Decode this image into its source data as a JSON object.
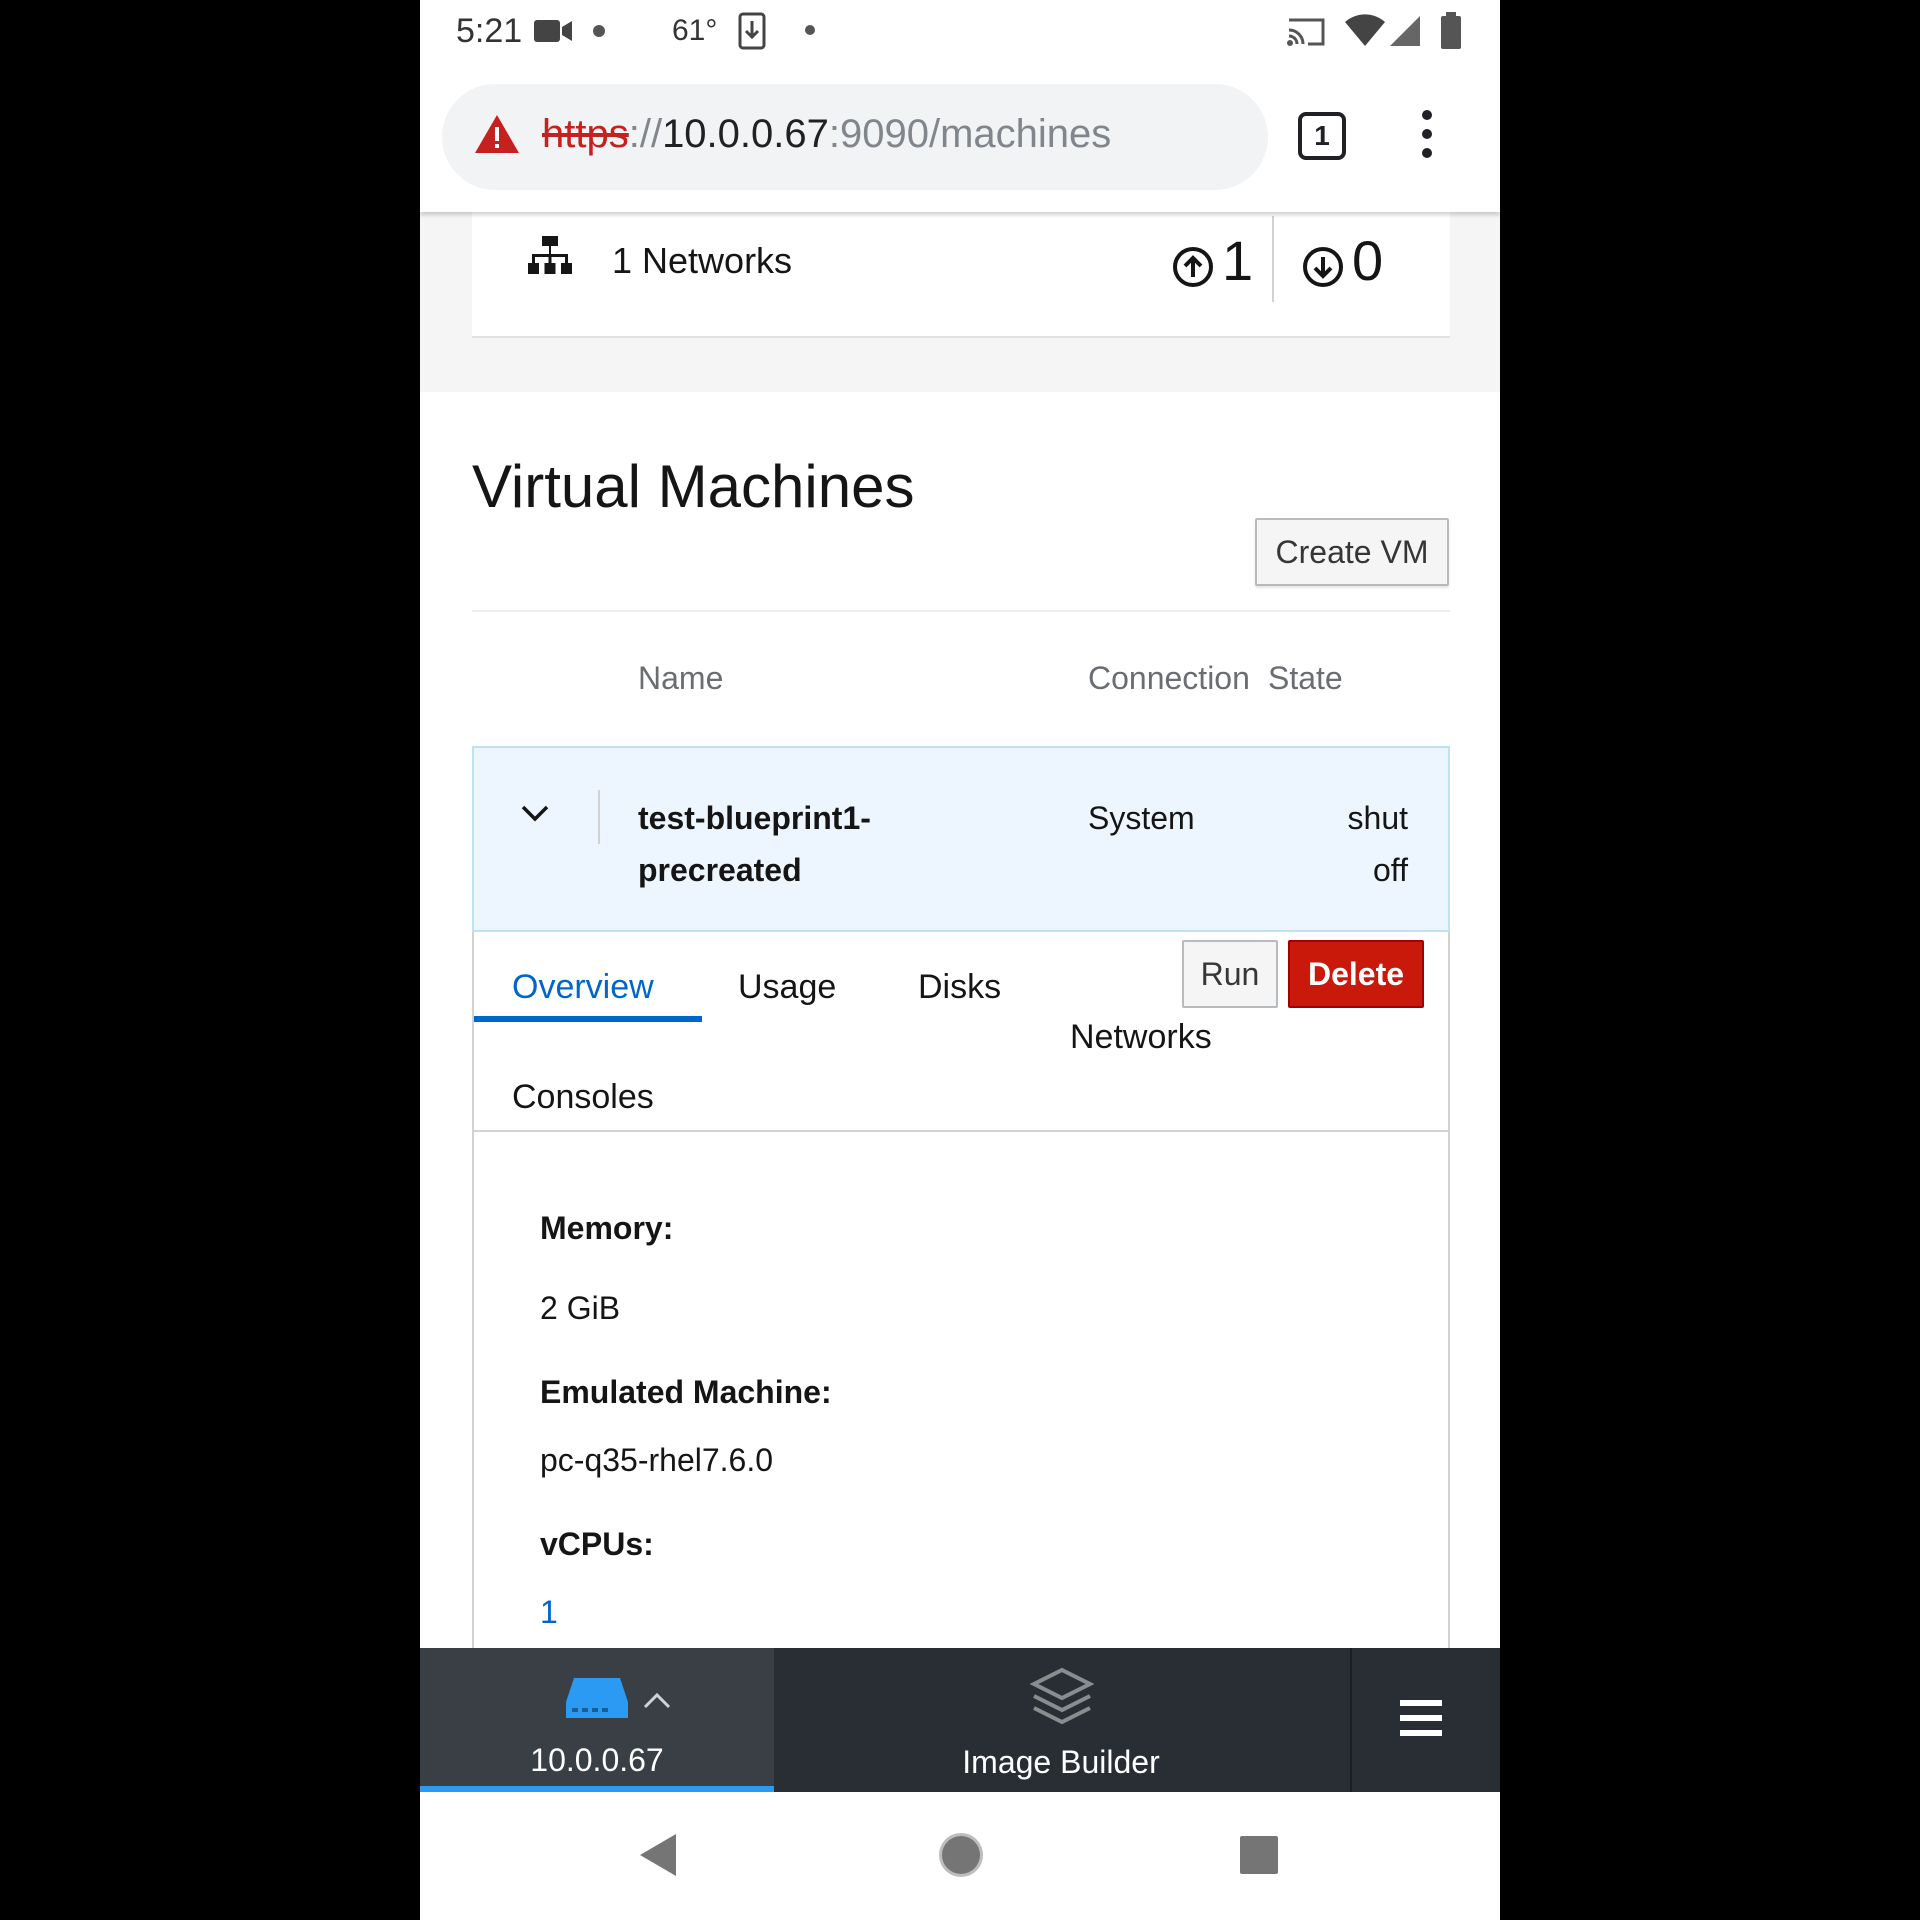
{
  "status_bar": {
    "time": "5:21",
    "temperature": "61°"
  },
  "browser": {
    "url_scheme": "https",
    "url_separator": "://",
    "url_host": "10.0.0.67",
    "url_rest": ":9090/machines",
    "tab_count": "1"
  },
  "networks_card": {
    "label": "1 Networks",
    "active": "1",
    "inactive": "0"
  },
  "vm_section": {
    "title": "Virtual Machines",
    "create_button": "Create VM",
    "columns": {
      "name": "Name",
      "connection": "Connection",
      "state": "State"
    }
  },
  "vm_row": {
    "name_line1": "test-blueprint1-",
    "name_line2": "precreated",
    "connection": "System",
    "state_line1": "shut",
    "state_line2": "off"
  },
  "vm_tabs": {
    "overview": "Overview",
    "usage": "Usage",
    "disks": "Disks",
    "networks": "Networks",
    "consoles": "Consoles",
    "active": "Overview"
  },
  "vm_actions": {
    "run": "Run",
    "delete": "Delete"
  },
  "overview": {
    "memory_label": "Memory:",
    "memory_value": "2 GiB",
    "machine_label": "Emulated Machine:",
    "machine_value": "pc-q35-rhel7.6.0",
    "vcpus_label": "vCPUs:",
    "vcpus_value": "1"
  },
  "bottom_nav": {
    "host": "10.0.0.67",
    "image_builder": "Image Builder"
  },
  "colors": {
    "link": "#0066cc",
    "danger": "#c9190b",
    "row_highlight": "#edf6ff",
    "nav_bg": "#292e34"
  }
}
